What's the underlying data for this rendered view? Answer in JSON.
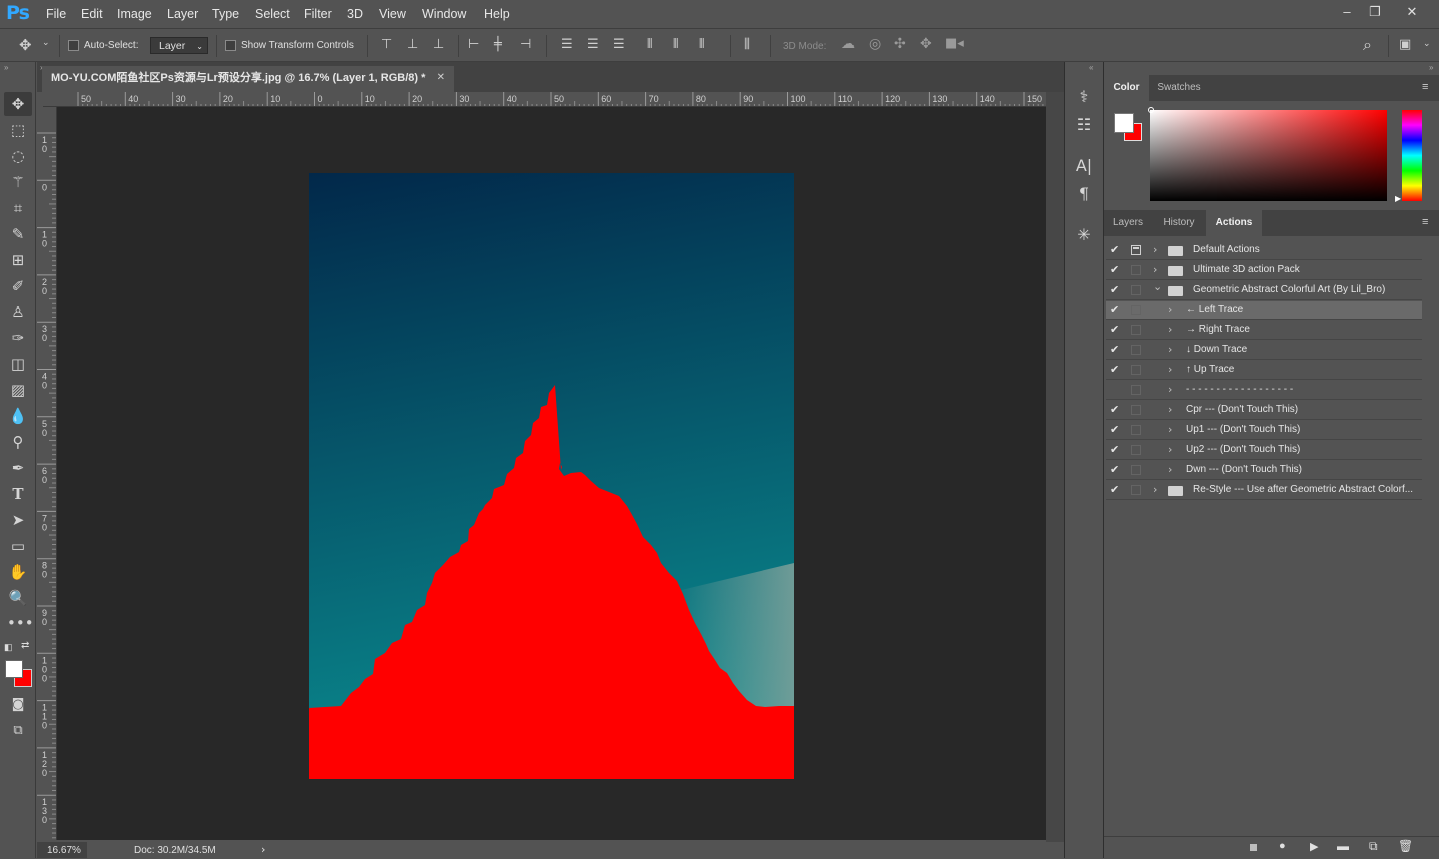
{
  "app": {
    "logo": "Ps",
    "menu": [
      "File",
      "Edit",
      "Image",
      "Layer",
      "Type",
      "Select",
      "Filter",
      "3D",
      "View",
      "Window",
      "Help"
    ]
  },
  "options": {
    "auto_select_label": "Auto-Select:",
    "auto_select_value": "Layer",
    "transform_label": "Show Transform Controls",
    "mode_label": "3D Mode:"
  },
  "document": {
    "tab_title": "MO-YU.COM陌鱼社区Ps资源与Lr预设分享.jpg @ 16.7% (Layer 1, RGB/8) *",
    "ruler_h": [
      "50",
      "40",
      "30",
      "20",
      "10",
      "0",
      "10",
      "20",
      "30",
      "40",
      "50",
      "60",
      "70",
      "80",
      "90",
      "100",
      "110",
      "120",
      "130",
      "140",
      "150"
    ],
    "ruler_v": [
      "1\n0",
      "0",
      "1\n0",
      "2\n0",
      "3\n0",
      "4\n0",
      "5\n0",
      "6\n0",
      "7\n0",
      "8\n0",
      "9\n0",
      "1\n0\n0",
      "1\n1\n0",
      "1\n2\n0",
      "1\n3\n0"
    ],
    "zoom": "16.67%",
    "doc_size": "Doc: 30.2M/34.5M"
  },
  "colors": {
    "foreground": "#ffffff",
    "background": "#ff0000",
    "sky_top": "#02284a",
    "sky_bottom": "#0a8a8e",
    "shape": "#ff0000"
  },
  "panels": {
    "color_tabs": [
      "Color",
      "Swatches"
    ],
    "action_tabs": [
      "Layers",
      "History",
      "Actions"
    ],
    "actions": [
      {
        "label": "Default Actions",
        "checked": true,
        "dialog": true,
        "level": 0,
        "expanded": false,
        "folder": true,
        "highlight": false
      },
      {
        "label": "Ultimate 3D action Pack",
        "checked": true,
        "dialog": false,
        "level": 0,
        "expanded": false,
        "folder": true,
        "highlight": false
      },
      {
        "label": "Geometric Abstract Colorful Art (By Lil_Bro)",
        "checked": true,
        "dialog": false,
        "level": 0,
        "expanded": true,
        "folder": true,
        "highlight": false
      },
      {
        "label": "← Left Trace",
        "checked": true,
        "dialog": false,
        "level": 1,
        "expanded": false,
        "folder": false,
        "highlight": true
      },
      {
        "label": "→ Right Trace",
        "checked": true,
        "dialog": false,
        "level": 1,
        "expanded": false,
        "folder": false,
        "highlight": false
      },
      {
        "label": "↓ Down Trace",
        "checked": true,
        "dialog": false,
        "level": 1,
        "expanded": false,
        "folder": false,
        "highlight": false
      },
      {
        "label": "↑ Up Trace",
        "checked": true,
        "dialog": false,
        "level": 1,
        "expanded": false,
        "folder": false,
        "highlight": false
      },
      {
        "label": "- - - - - - - - - - - - - - - - - -",
        "checked": false,
        "dialog": false,
        "level": 1,
        "expanded": false,
        "folder": false,
        "highlight": false
      },
      {
        "label": "Cpr --- (Don't Touch This)",
        "checked": true,
        "dialog": false,
        "level": 1,
        "expanded": false,
        "folder": false,
        "highlight": false
      },
      {
        "label": "Up1 --- (Don't Touch This)",
        "checked": true,
        "dialog": false,
        "level": 1,
        "expanded": false,
        "folder": false,
        "highlight": false
      },
      {
        "label": "Up2 --- (Don't Touch This)",
        "checked": true,
        "dialog": false,
        "level": 1,
        "expanded": false,
        "folder": false,
        "highlight": false
      },
      {
        "label": "Dwn --- (Don't Touch This)",
        "checked": true,
        "dialog": false,
        "level": 1,
        "expanded": false,
        "folder": false,
        "highlight": false
      },
      {
        "label": "Re-Style --- Use after Geometric Abstract Colorf...",
        "checked": true,
        "dialog": false,
        "level": 0,
        "expanded": false,
        "folder": true,
        "highlight": false
      }
    ]
  }
}
